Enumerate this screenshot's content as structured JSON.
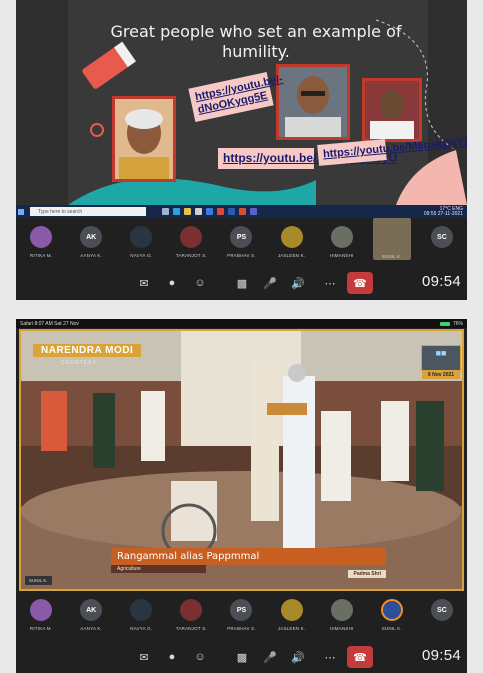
{
  "slide": {
    "title": "Great people who set an example of humility.",
    "links": [
      "https://youtu.be/-dNoOKyqg5E",
      "https://youtu.be/XvzAyJgAoyU",
      "https://youtu.be/M6gakOkYDHM"
    ]
  },
  "taskbar": {
    "search_placeholder": "Type here to search",
    "tray_temp": "17°C",
    "tray_lang": "ENG",
    "tray_time": "09:55",
    "tray_date": "27-11-2021"
  },
  "meeting_top": {
    "participants": [
      {
        "label": "RITIKA M.",
        "initials": "",
        "color": "#8a5aa8"
      },
      {
        "label": "AANYA K.",
        "initials": "AK",
        "color": "#4b4f55"
      },
      {
        "label": "NAVYA G.",
        "initials": "",
        "color": "#2a3542"
      },
      {
        "label": "TARANJOT S.",
        "initials": "",
        "color": "#7a3030"
      },
      {
        "label": "PRABHAV S.",
        "initials": "PS",
        "color": "#4b4f55"
      },
      {
        "label": "JASLEEN K.",
        "initials": "",
        "color": "#a88a2a"
      },
      {
        "label": "HIMANSHI",
        "initials": "",
        "color": "#6a6f65"
      },
      {
        "label": "SUNIL K.",
        "initials": "",
        "color": "#7a6d55",
        "active": true
      },
      {
        "label": "",
        "initials": "SC",
        "color": "#4b4f55"
      }
    ],
    "clock": "09:54"
  },
  "ios_status": {
    "left": "Safari  8:07 AM  Sat 27 Nov",
    "battery": "76%"
  },
  "video": {
    "ribbon": "NARENDRA MODI",
    "courtesy": "COURTESY",
    "chip_date": "9 Nov 2021",
    "lower_name": "Rangammal alias Pappmmal",
    "lower_category": "Agriculture",
    "lower_award": "Padma Shri",
    "name_tag": "SUNIL K."
  },
  "meeting_bottom": {
    "participants": [
      {
        "label": "RITIKA M.",
        "initials": "",
        "color": "#8a5aa8"
      },
      {
        "label": "AANYA K.",
        "initials": "AK",
        "color": "#4b4f55"
      },
      {
        "label": "NAVYA G.",
        "initials": "",
        "color": "#2a3542"
      },
      {
        "label": "TARANJOT S.",
        "initials": "",
        "color": "#7a3030"
      },
      {
        "label": "PRABHAV S.",
        "initials": "PS",
        "color": "#4b4f55"
      },
      {
        "label": "JASLEEN K.",
        "initials": "",
        "color": "#a88a2a"
      },
      {
        "label": "HIMANSHI",
        "initials": "",
        "color": "#6a6f65"
      },
      {
        "label": "SUNIL K.",
        "initials": "",
        "color": "#2b4f9a",
        "active": true
      },
      {
        "label": "",
        "initials": "SC",
        "color": "#4b4f55"
      }
    ],
    "clock": "09:54"
  },
  "colors": {
    "accent_red": "#c43b3b",
    "frame_gold": "#d9a33a",
    "link_card": "#f6c9c4"
  }
}
